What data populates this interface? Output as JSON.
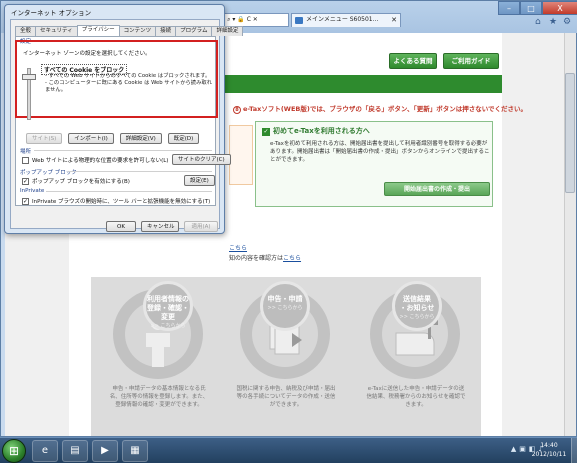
{
  "browser": {
    "address_text": "S50109) ⌕ ▾ 🔒 C ✕",
    "tab_label": "メインメニュー S60501…",
    "tab_close": "✕",
    "minimize": "–",
    "maximize": "□",
    "close": "X",
    "home_icon": "⌂",
    "star_icon": "★",
    "gear_icon": "⚙"
  },
  "page": {
    "faq_button": "よくある質問",
    "guide_button": "ご利用ガイド",
    "notice_marker": "8",
    "notice_text": "e-Taxソフト(WEB版)では、ブラウザの「戻る」ボタン、「更新」ボタンは押さないでください。",
    "first_box": {
      "check": "✓",
      "title": "初めてe-Taxを利用される方へ",
      "text": "e-Taxを初めて利用される方は、開始届出書を提出して利用者識別番号を取得する必要があります。開始届出書は「開始届出書の作成・提出」ボタンからオンラインで提出することができます。",
      "button": "開始届出書の作成・提出"
    },
    "link1": "こちら",
    "link2_prefix": "知の内容を確認方は",
    "link2_link": "こちら",
    "cards": [
      {
        "badge_lines": [
          "利用者情報の",
          "登録・確認・変更"
        ],
        "badge_sub": ">> こちらから",
        "text": "申告・申請データの基本情報となる氏名、住所等の情報を登録します。また、登録情報の確認・変更ができます。"
      },
      {
        "badge_lines": [
          "申告・申請"
        ],
        "badge_sub": ">> こちらから",
        "text": "国税に関する申告、納税及び申請・届出等の各手続についてデータの作成・送信ができます。"
      },
      {
        "badge_lines": [
          "送信結果",
          "・お知らせ"
        ],
        "badge_sub": ">> こちらから",
        "text": "e-Taxに送信した申告・申請データの送信結果、税務署からのお知らせを確認できます。"
      }
    ]
  },
  "dialog": {
    "title": "インターネット オプション",
    "tabs": [
      "全般",
      "セキュリティ",
      "プライバシー",
      "コンテンツ",
      "接続",
      "プログラム",
      "詳細設定"
    ],
    "active_tab": 2,
    "settings_section": "設定",
    "settings_desc": "インターネット ゾーンの設定を選択してください。",
    "level_title": "すべての Cookie をブロック",
    "level_desc_1": "- すべての Web サイトからのすべての Cookie はブロックされます。",
    "level_desc_2": "- このコンピューターに既にある Cookie は Web サイトから読み取れません。",
    "buttons_row": [
      "サイト(S)",
      "インポート(I)",
      "詳細設定(V)",
      "既定(D)"
    ],
    "location_section": "場所",
    "location_check_label": "Web サイトによる物理的な位置の要求を許可しない(L)",
    "location_button": "サイトのクリア(C)",
    "popup_section": "ポップアップ ブロック",
    "popup_check_label": "ポップアップ ブロックを有効にする(B)",
    "popup_check_mark": "✓",
    "popup_button": "設定(E)",
    "inprivate_section": "InPrivate",
    "inprivate_check_label": "InPrivate ブラウズの開始時に、ツール バーと拡張機能を無効にする(T)",
    "inprivate_check_mark": "✓",
    "ok": "OK",
    "cancel": "キャンセル",
    "apply": "適用(A)"
  },
  "taskbar": {
    "start_glyph": "⊞",
    "icons": [
      "e",
      "▤",
      "▶",
      "▦"
    ],
    "tray_glyphs": [
      "▲",
      "▣",
      "◧",
      "♪"
    ],
    "time": "14:40",
    "date": "2012/10/11"
  }
}
